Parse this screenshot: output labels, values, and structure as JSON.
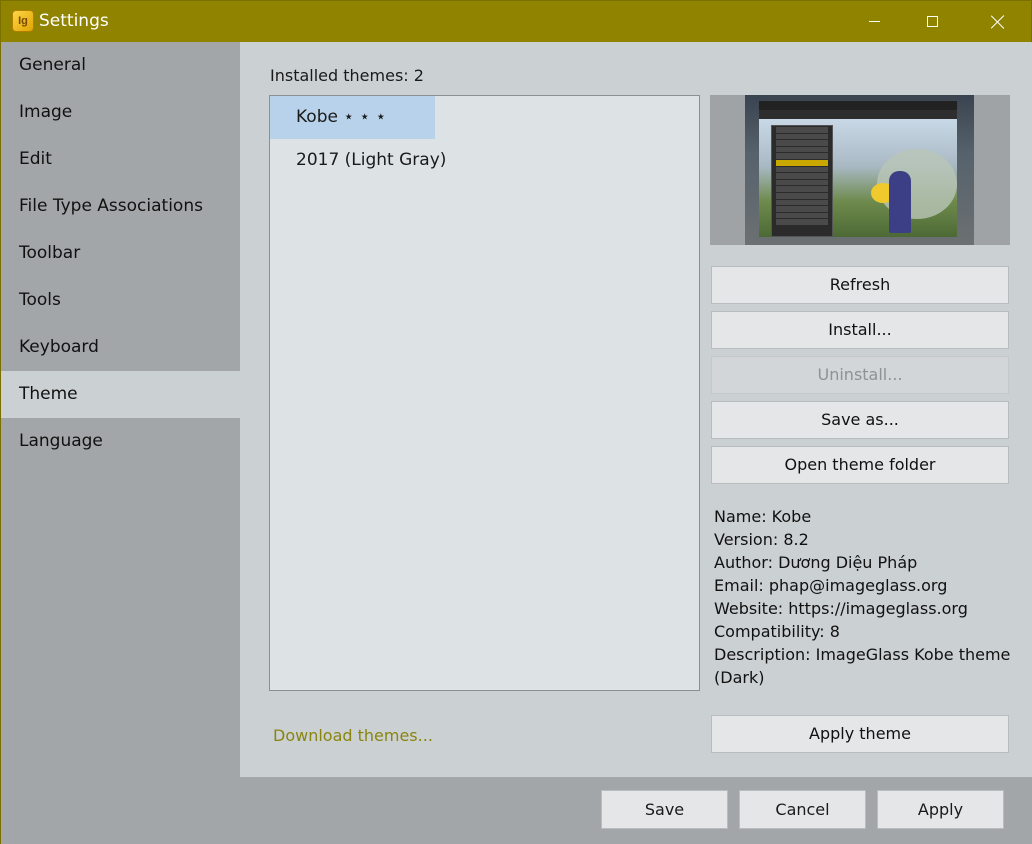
{
  "window": {
    "title": "Settings",
    "app_icon_text": "Ig",
    "accent_color": "#8f8300"
  },
  "sidebar": {
    "items": [
      {
        "label": "General"
      },
      {
        "label": "Image"
      },
      {
        "label": "Edit"
      },
      {
        "label": "File Type Associations"
      },
      {
        "label": "Toolbar"
      },
      {
        "label": "Tools"
      },
      {
        "label": "Keyboard"
      },
      {
        "label": "Theme",
        "active": true
      },
      {
        "label": "Language"
      }
    ]
  },
  "theme_panel": {
    "installed_label": "Installed themes: 2",
    "themes": [
      {
        "label": "Kobe ⋆ ⋆ ⋆",
        "selected": true
      },
      {
        "label": "2017 (Light Gray)"
      }
    ],
    "buttons": {
      "refresh": "Refresh",
      "install": "Install...",
      "uninstall": "Uninstall...",
      "save_as": "Save as...",
      "open_folder": "Open theme folder",
      "apply_theme": "Apply theme"
    },
    "info": {
      "name": "Name: Kobe",
      "version": "Version: 8.2",
      "author": "Author: Dương Diệu Pháp",
      "email": "Email: phap@imageglass.org",
      "website": "Website: https://imageglass.org",
      "compatibility": "Compatibility: 8",
      "description": "Description: ImageGlass Kobe theme (Dark)"
    },
    "download_link": "Download themes..."
  },
  "footer": {
    "save": "Save",
    "cancel": "Cancel",
    "apply": "Apply"
  }
}
